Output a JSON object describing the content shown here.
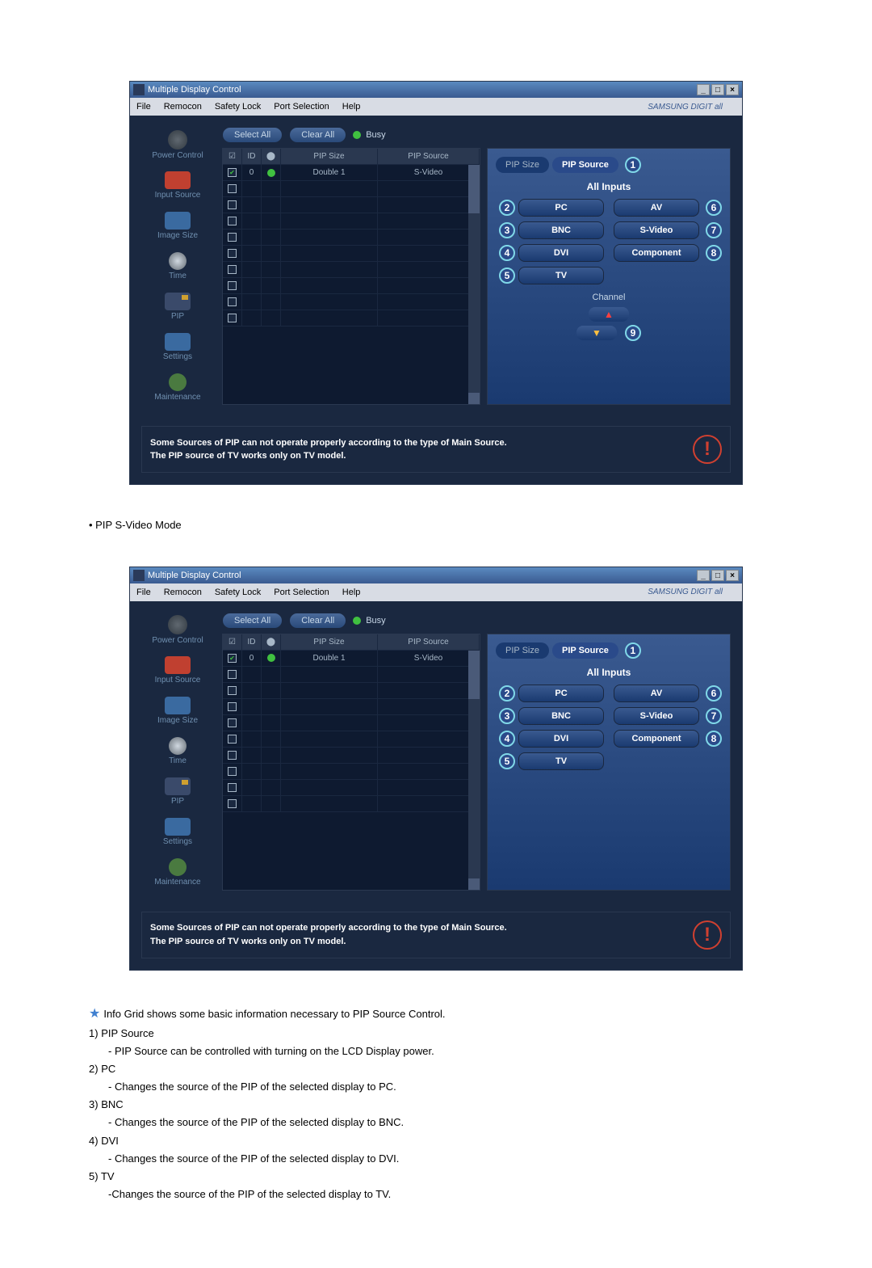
{
  "window": {
    "title": "Multiple Display Control",
    "menu": [
      "File",
      "Remocon",
      "Safety Lock",
      "Port Selection",
      "Help"
    ],
    "brand": "SAMSUNG DIGIT all"
  },
  "sidebar": [
    {
      "label": "Power Control",
      "icon": "power"
    },
    {
      "label": "Input Source",
      "icon": "input"
    },
    {
      "label": "Image Size",
      "icon": "image"
    },
    {
      "label": "Time",
      "icon": "time"
    },
    {
      "label": "PIP",
      "icon": "pip"
    },
    {
      "label": "Settings",
      "icon": "settings"
    },
    {
      "label": "Maintenance",
      "icon": "maint"
    }
  ],
  "topbar": {
    "select_all": "Select All",
    "clear_all": "Clear All",
    "busy": "Busy"
  },
  "table": {
    "headers": {
      "id": "ID",
      "size": "PIP Size",
      "source": "PIP Source"
    },
    "row0": {
      "checked": true,
      "id": "0",
      "led_on": true,
      "size": "Double 1",
      "source": "S-Video"
    }
  },
  "panel": {
    "tab_size": "PIP Size",
    "tab_source": "PIP Source",
    "header": "All Inputs",
    "inputs_left": [
      "PC",
      "BNC",
      "DVI",
      "TV"
    ],
    "inputs_right": [
      "AV",
      "S-Video",
      "Component"
    ],
    "callouts_left": [
      "2",
      "3",
      "4",
      "5"
    ],
    "callouts_right": [
      "6",
      "7",
      "8"
    ],
    "top_callout": "1",
    "channel_label": "Channel",
    "channel_callout": "9"
  },
  "notice": {
    "line1": "Some Sources of PIP can not operate properly according to the type of Main Source.",
    "line2": "The PIP source of TV works only on TV model."
  },
  "doc": {
    "section": "PIP S-Video Mode",
    "star_line": "Info Grid shows some basic information necessary to PIP Source Control.",
    "items": [
      {
        "num": "1)",
        "title": "PIP Source",
        "desc": "- PIP Source can be controlled with turning on the LCD Display power."
      },
      {
        "num": "2)",
        "title": "PC",
        "desc": "- Changes the source of the PIP of the selected display to PC."
      },
      {
        "num": "3)",
        "title": "BNC",
        "desc": "- Changes the source of the PIP of the selected display to BNC."
      },
      {
        "num": "4)",
        "title": "DVI",
        "desc": "- Changes the source of the PIP of the selected display to DVI."
      },
      {
        "num": "5)",
        "title": "TV",
        "desc": "-Changes the source of the PIP of the selected display to TV."
      }
    ]
  }
}
